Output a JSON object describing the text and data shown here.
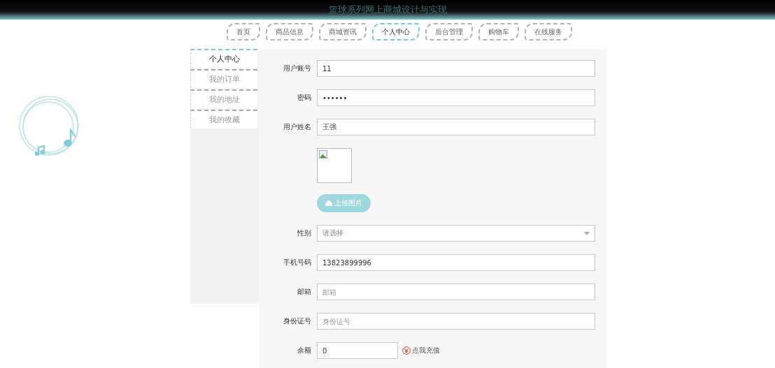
{
  "header": {
    "title": "篮球系列网上商城设计与实现"
  },
  "nav": [
    {
      "label": "首页",
      "selected": false
    },
    {
      "label": "商品信息",
      "selected": false
    },
    {
      "label": "商城资讯",
      "selected": false
    },
    {
      "label": "个人中心",
      "selected": true
    },
    {
      "label": "后台管理",
      "selected": false
    },
    {
      "label": "购物车",
      "selected": false
    },
    {
      "label": "在线服务",
      "selected": false
    }
  ],
  "sidebar": {
    "items": [
      {
        "label": "个人中心",
        "selected": true
      },
      {
        "label": "我的订单",
        "selected": false
      },
      {
        "label": "我的地址",
        "selected": false
      },
      {
        "label": "我的收藏",
        "selected": false
      }
    ]
  },
  "form": [
    {
      "kind": "text",
      "label": "用户账号",
      "value": "11"
    },
    {
      "kind": "text",
      "label": "密码",
      "value": "••••••"
    },
    {
      "kind": "text",
      "label": "用户姓名",
      "value": "王强"
    },
    {
      "kind": "image"
    },
    {
      "kind": "upload",
      "button": "上传图片"
    },
    {
      "kind": "select",
      "label": "性别",
      "placeholder": "请选择"
    },
    {
      "kind": "text",
      "label": "手机号码",
      "value": "13823899996"
    },
    {
      "kind": "text",
      "label": "邮箱",
      "placeholder": "邮箱"
    },
    {
      "kind": "text",
      "label": "身份证号",
      "placeholder": "身份证号"
    },
    {
      "kind": "balance",
      "label": "余额",
      "value": "0",
      "link": "点我充值"
    }
  ]
}
